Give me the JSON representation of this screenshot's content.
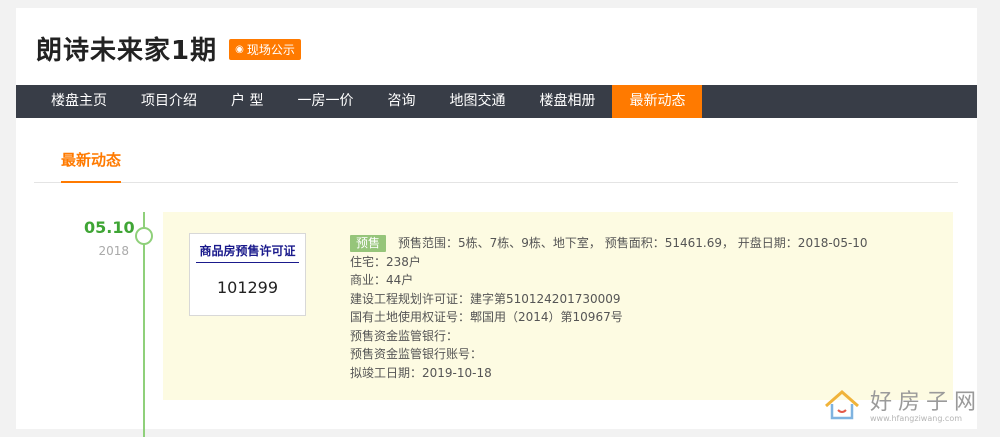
{
  "header": {
    "title": "朗诗未来家1期",
    "badge_label": "现场公示"
  },
  "nav": {
    "items": [
      "楼盘主页",
      "项目介绍",
      "户 型",
      "一房一价",
      "咨询",
      "地图交通",
      "楼盘相册",
      "最新动态"
    ],
    "active": "最新动态"
  },
  "section": {
    "tab_label": "最新动态"
  },
  "timeline": {
    "date": "05.10",
    "year": "2018",
    "permit_title": "商品房预售许可证",
    "permit_number": "101299",
    "tag": "预售",
    "details": [
      "预售范围：5栋、7栋、9栋、地下室，  预售面积：51461.69，  开盘日期：2018-05-10",
      "住宅：238户",
      "商业：44户",
      "建设工程规划许可证：建字第510124201730009",
      "国有土地使用权证号：郫国用（2014）第10967号",
      "预售资金监管银行：",
      "预售资金监管银行账号：",
      "拟竣工日期：2019-10-18"
    ]
  },
  "watermark": {
    "title": "好房子网",
    "url": "www.hfangziwang.com"
  },
  "colors": {
    "accent": "#ff7a00",
    "nav_bg": "#383d47",
    "timeline_green": "#3fa535",
    "entry_bg": "#fdfbe2",
    "tag_bg": "#96c57a"
  },
  "icons": {
    "badge": "eye-icon",
    "watermark": "house-logo-icon"
  }
}
